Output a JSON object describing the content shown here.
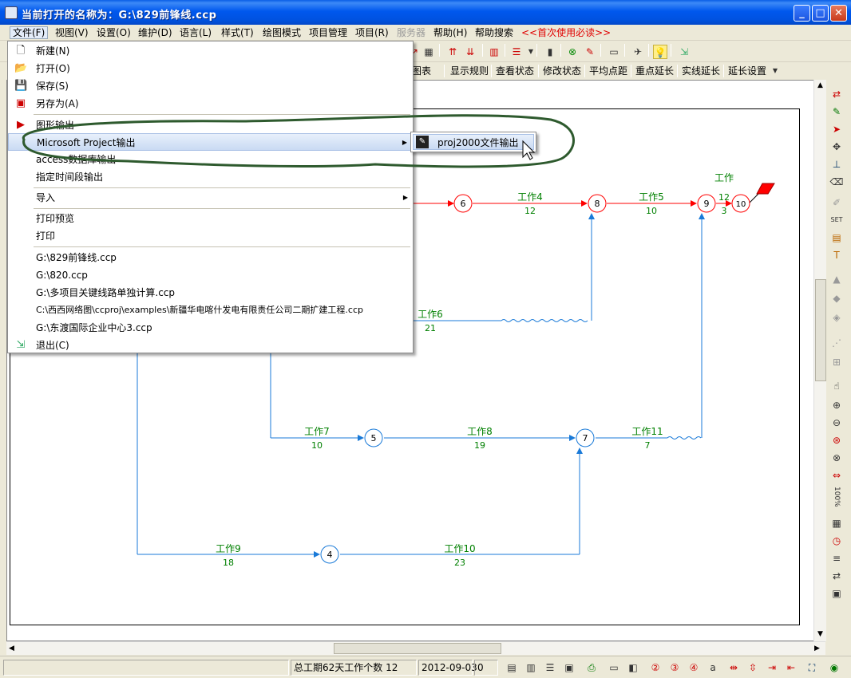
{
  "window": {
    "title": "当前打开的名称为：G:\\829前锋线.ccp",
    "minimize_glyph": "_",
    "maximize_glyph": "□",
    "close_glyph": "✕"
  },
  "menubar": {
    "items": [
      "文件(F)",
      "视图(V)",
      "设置(O)",
      "维护(D)",
      "语言(L)",
      "样式(T)",
      "绘图模式",
      "项目管理",
      "项目(R)",
      "服务器",
      "帮助(H)",
      "帮助搜索",
      "<<首次使用必读>>"
    ]
  },
  "toolbar2": {
    "items": [
      "图表",
      "显示规则",
      "查看状态",
      "修改状态",
      "平均点距",
      "重点延长",
      "实线延长",
      "延长设置"
    ]
  },
  "file_menu": {
    "items": [
      {
        "label": "新建(N)",
        "icon": "new-file-icon"
      },
      {
        "label": "打开(O)",
        "icon": "open-folder-icon"
      },
      {
        "label": "保存(S)",
        "icon": "save-icon"
      },
      {
        "label": "另存为(A)",
        "icon": "save-as-icon"
      },
      {
        "label": "图形输出",
        "icon": "graphic-export-icon"
      },
      {
        "label": "Microsoft Project输出",
        "icon": ""
      },
      {
        "label": "access数据库输出",
        "icon": ""
      },
      {
        "label": "指定时间段输出",
        "icon": ""
      },
      {
        "label": "导入",
        "icon": ""
      },
      {
        "label": "打印预览",
        "icon": ""
      },
      {
        "label": "打印",
        "icon": ""
      },
      {
        "label": "G:\\829前锋线.ccp",
        "icon": ""
      },
      {
        "label": "G:\\820.ccp",
        "icon": ""
      },
      {
        "label": "G:\\多项目关键线路单独计算.ccp",
        "icon": ""
      },
      {
        "label": "C:\\西西网络图\\ccproj\\examples\\新疆华电喀什发电有限责任公司二期扩建工程.ccp",
        "icon": ""
      },
      {
        "label": "G:\\东渡国际企业中心3.ccp",
        "icon": ""
      },
      {
        "label": "退出(C)",
        "icon": "exit-icon"
      }
    ]
  },
  "submenu": {
    "item": "proj2000文件输出"
  },
  "diagram": {
    "nodes": [
      "4",
      "5",
      "6",
      "7",
      "8",
      "9",
      "10"
    ],
    "activities": [
      {
        "name": "工作4",
        "duration": "12"
      },
      {
        "name": "工作5",
        "duration": "10"
      },
      {
        "name": "工作",
        "name2": "12",
        "duration": "3"
      },
      {
        "name": "工作6",
        "duration": "21"
      },
      {
        "name": "工作7",
        "duration": "10"
      },
      {
        "name": "工作8",
        "duration": "19"
      },
      {
        "name": "工作11",
        "duration": "7"
      },
      {
        "name": "工作9",
        "duration": "18"
      },
      {
        "name": "工作10",
        "duration": "23"
      }
    ],
    "colors": {
      "critical": "#ff0000",
      "normal": "#1a7ad8",
      "label": "#008000",
      "annotation": "#2e5a2e"
    }
  },
  "statusbar": {
    "summary": "总工期62天工作个数 12",
    "date": "2012-09-03",
    "value": "0"
  },
  "rightbar": {
    "zoom": "100%"
  }
}
